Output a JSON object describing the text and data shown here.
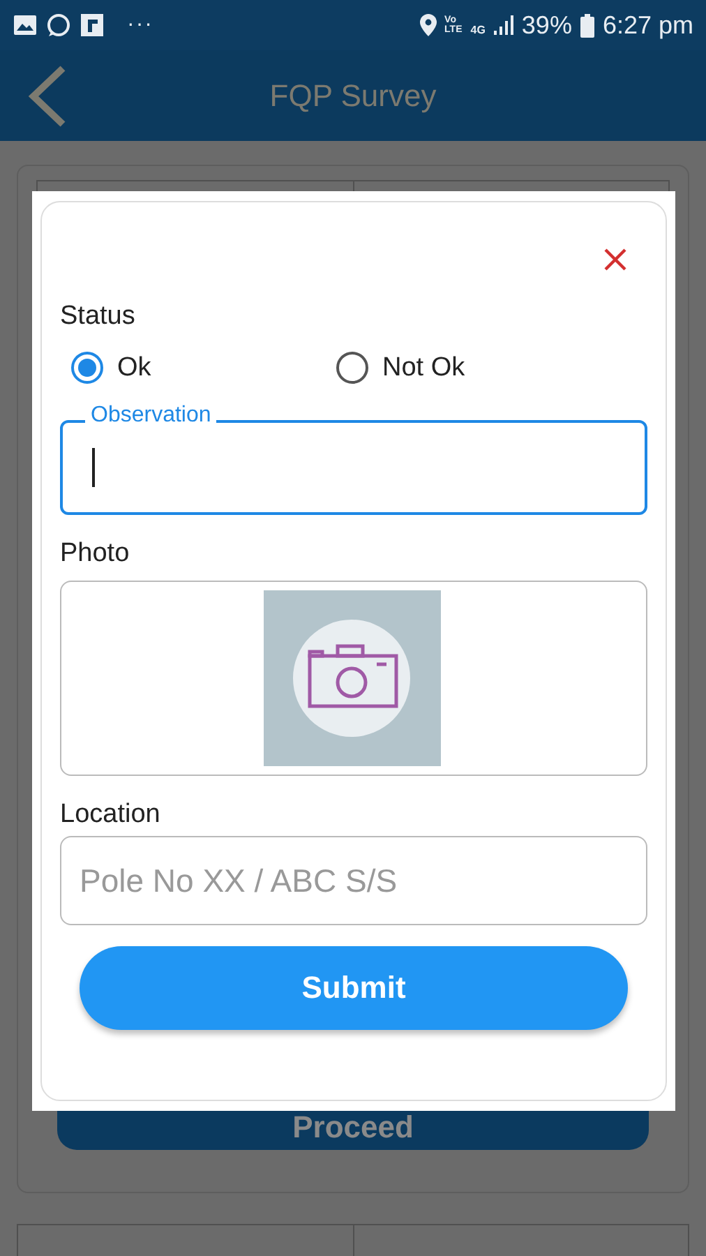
{
  "status_bar": {
    "more": "···",
    "volte": [
      "Vo",
      "LTE"
    ],
    "network": "4G",
    "battery": "39%",
    "time": "6:27 pm"
  },
  "app_bar": {
    "title": "FQP Survey"
  },
  "background": {
    "proceed_button": "Proceed"
  },
  "dialog": {
    "status_label": "Status",
    "options": [
      {
        "label": "Ok",
        "selected": true
      },
      {
        "label": "Not Ok",
        "selected": false
      }
    ],
    "observation": {
      "label": "Observation",
      "focused": true
    },
    "photo_label": "Photo",
    "location_label": "Location",
    "location": {
      "placeholder": "Pole No XX / ABC S/S"
    },
    "submit": "Submit"
  }
}
